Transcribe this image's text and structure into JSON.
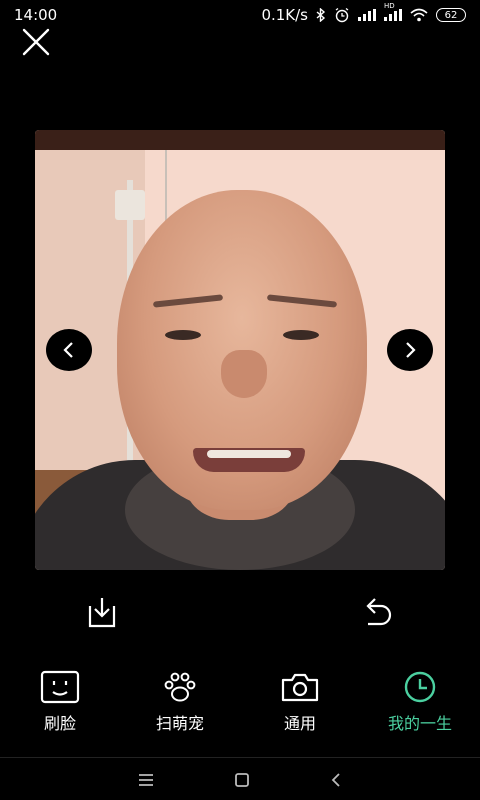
{
  "status_bar": {
    "time": "14:00",
    "network_speed": "0.1K/s",
    "hd_label": "HD",
    "battery_level": "62"
  },
  "toolbar": {
    "close_icon": "close-icon",
    "download_icon": "download-icon",
    "undo_icon": "undo-icon"
  },
  "photo": {
    "prev_icon": "chevron-left-icon",
    "next_icon": "chevron-right-icon"
  },
  "tabs": [
    {
      "label": "刷脸",
      "icon": "face-scan-icon",
      "active": false
    },
    {
      "label": "扫萌宠",
      "icon": "paw-icon",
      "active": false
    },
    {
      "label": "通用",
      "icon": "camera-icon",
      "active": false
    },
    {
      "label": "我的一生",
      "icon": "clock-icon",
      "active": true
    }
  ],
  "colors": {
    "accent": "#4bd0a0",
    "background": "#000000"
  },
  "system_nav": {
    "menu_icon": "menu-icon",
    "home_icon": "home-icon",
    "back_icon": "back-icon"
  }
}
